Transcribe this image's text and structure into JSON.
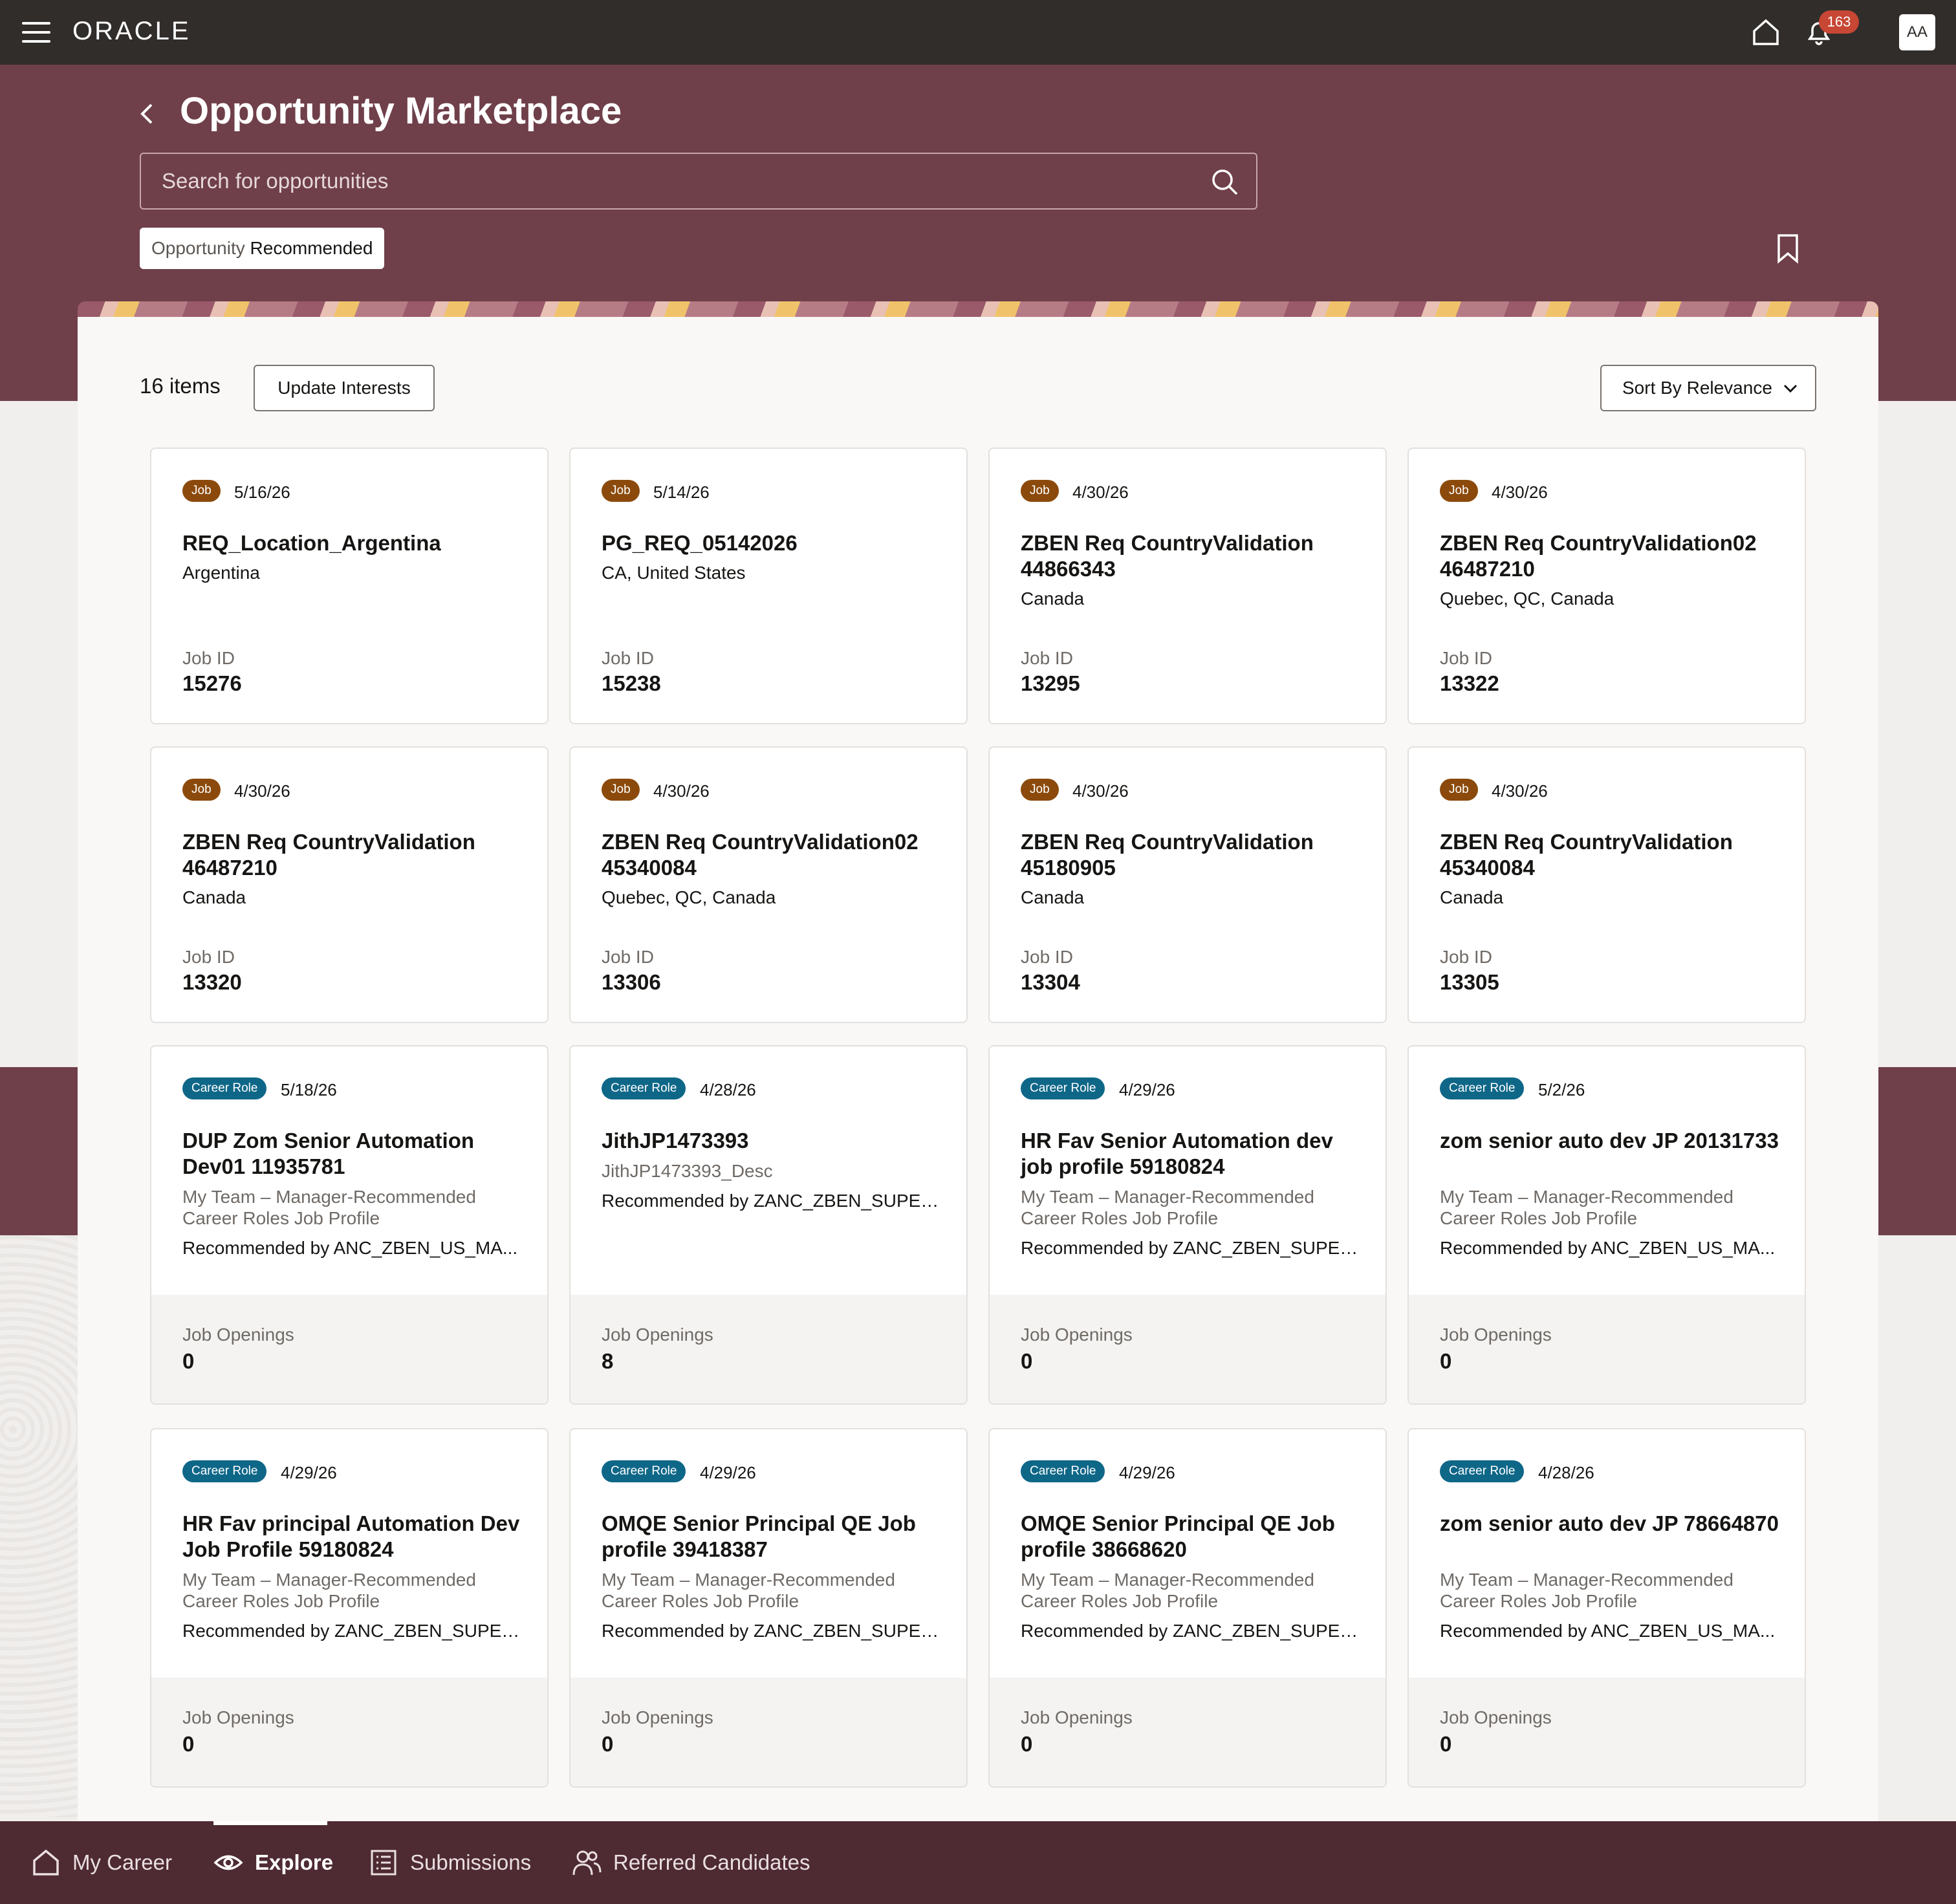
{
  "header": {
    "logo": "ORACLE",
    "notification_count": "163",
    "avatar_initials": "AA"
  },
  "page": {
    "title": "Opportunity Marketplace",
    "search_placeholder": "Search for opportunities",
    "filter_chip_prefix": "Opportunity",
    "filter_chip_value": "Recommended"
  },
  "toolbar": {
    "items_count": "16 items",
    "update_interests_label": "Update Interests",
    "sort_prefix": "Sort By",
    "sort_value": "Relevance"
  },
  "labels": {
    "job_id": "Job ID",
    "job_openings": "Job Openings"
  },
  "cards": [
    {
      "tag": "Job",
      "date": "5/16/26",
      "title": "REQ_Location_Argentina",
      "location": "Argentina",
      "meta": "15276"
    },
    {
      "tag": "Job",
      "date": "5/14/26",
      "title": "PG_REQ_05142026",
      "location": "CA, United States",
      "meta": "15238"
    },
    {
      "tag": "Job",
      "date": "4/30/26",
      "title": "ZBEN Req CountryValidation 44866343",
      "location": "Canada",
      "meta": "13295"
    },
    {
      "tag": "Job",
      "date": "4/30/26",
      "title": "ZBEN Req CountryValidation02 46487210",
      "location": "Quebec, QC, Canada",
      "meta": "13322"
    },
    {
      "tag": "Job",
      "date": "4/30/26",
      "title": "ZBEN Req CountryValidation 46487210",
      "location": "Canada",
      "meta": "13320"
    },
    {
      "tag": "Job",
      "date": "4/30/26",
      "title": "ZBEN Req CountryValidation02 45340084",
      "location": "Quebec, QC, Canada",
      "meta": "13306"
    },
    {
      "tag": "Job",
      "date": "4/30/26",
      "title": "ZBEN Req CountryValidation 45180905",
      "location": "Canada",
      "meta": "13304"
    },
    {
      "tag": "Job",
      "date": "4/30/26",
      "title": "ZBEN Req CountryValidation 45340084",
      "location": "Canada",
      "meta": "13305"
    },
    {
      "tag": "Career Role",
      "date": "5/18/26",
      "title": "DUP Zom Senior Automation Dev01 11935781",
      "desc": "My Team – Manager-Recommended Career Roles Job Profile",
      "rec": "Recommended by ANC_ZBEN_US_MA...",
      "meta": "0"
    },
    {
      "tag": "Career Role",
      "date": "4/28/26",
      "title": "JithJP1473393",
      "desc": "JithJP1473393_Desc",
      "rec": "Recommended by ZANC_ZBEN_SUPER...",
      "meta": "8"
    },
    {
      "tag": "Career Role",
      "date": "4/29/26",
      "title": "HR Fav Senior Automation dev job profile 59180824",
      "desc": "My Team – Manager-Recommended Career Roles Job Profile",
      "rec": "Recommended by ZANC_ZBEN_SUPER...",
      "meta": "0"
    },
    {
      "tag": "Career Role",
      "date": "5/2/26",
      "title": "zom senior auto dev JP 20131733",
      "desc": "My Team – Manager-Recommended Career Roles Job Profile",
      "rec": "Recommended by ANC_ZBEN_US_MA...",
      "meta": "0"
    },
    {
      "tag": "Career Role",
      "date": "4/29/26",
      "title": "HR Fav principal Automation Dev Job Profile 59180824",
      "desc": "My Team – Manager-Recommended Career Roles Job Profile",
      "rec": "Recommended by ZANC_ZBEN_SUPER...",
      "meta": "0"
    },
    {
      "tag": "Career Role",
      "date": "4/29/26",
      "title": "OMQE Senior Principal QE Job profile 39418387",
      "desc": "My Team – Manager-Recommended Career Roles Job Profile",
      "rec": "Recommended by ZANC_ZBEN_SUPER...",
      "meta": "0"
    },
    {
      "tag": "Career Role",
      "date": "4/29/26",
      "title": "OMQE Senior Principal QE Job profile 38668620",
      "desc": "My Team – Manager-Recommended Career Roles Job Profile",
      "rec": "Recommended by ZANC_ZBEN_SUPER...",
      "meta": "0"
    },
    {
      "tag": "Career Role",
      "date": "4/28/26",
      "title": "zom senior auto dev JP 78664870",
      "desc": "My Team – Manager-Recommended Career Roles Job Profile",
      "rec": "Recommended by ANC_ZBEN_US_MA...",
      "meta": "0"
    }
  ],
  "bottom_nav": [
    {
      "label": "My Career",
      "icon": "home-icon"
    },
    {
      "label": "Explore",
      "icon": "eye-icon",
      "active": true
    },
    {
      "label": "Submissions",
      "icon": "list-icon"
    },
    {
      "label": "Referred Candidates",
      "icon": "people-icon"
    }
  ],
  "colors": {
    "header_bg": "#312d2a",
    "brand_band": "#6f3f4a",
    "job_tag": "#8b4a0b",
    "career_role_tag": "#0f6788",
    "notification_badge": "#c74634",
    "bottom_nav_bg": "#4e2a33"
  }
}
